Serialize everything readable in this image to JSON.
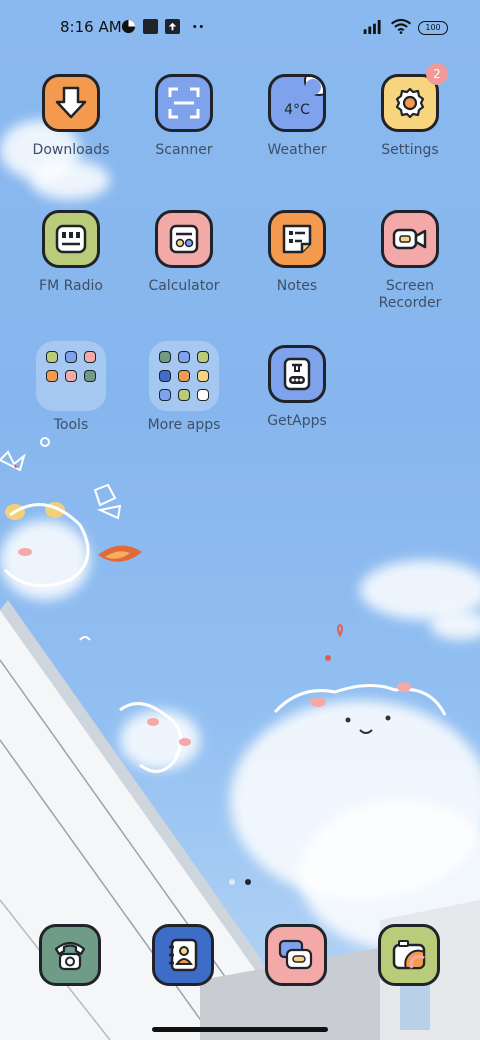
{
  "status_bar": {
    "time": "8:16 AM",
    "battery": "100",
    "left_icons": [
      "data-saver-icon",
      "square-notification-icon",
      "upload-notification-icon",
      "more-dots-icon"
    ],
    "right_icons": [
      "signal-icon",
      "wifi-icon",
      "battery-icon"
    ]
  },
  "apps": {
    "downloads": {
      "label": "Downloads",
      "color": "#f39a4f"
    },
    "scanner": {
      "label": "Scanner",
      "color": "#7ea3ec"
    },
    "weather": {
      "label": "Weather",
      "color": "#7ea3ec",
      "temp": "4°C"
    },
    "settings": {
      "label": "Settings",
      "color": "#f7d57e",
      "badge": "2"
    },
    "fm_radio": {
      "label": "FM Radio",
      "color": "#b8cc7a"
    },
    "calculator": {
      "label": "Calculator",
      "color": "#f4a9a9"
    },
    "notes": {
      "label": "Notes",
      "color": "#f39a4f"
    },
    "screen_recorder": {
      "label": "Screen\nRecorder",
      "color": "#f4a9a9"
    },
    "tools": {
      "label": "Tools"
    },
    "more_apps": {
      "label": "More apps"
    },
    "getapps": {
      "label": "GetApps",
      "color": "#7ea3ec"
    }
  },
  "dock": {
    "phone": {
      "color": "#6e9c86"
    },
    "contacts": {
      "color": "#3e6dc8"
    },
    "messages": {
      "color": "#f4a9a9"
    },
    "camera": {
      "color": "#b8cc7a"
    }
  },
  "page_indicator": {
    "count": 2,
    "active": 2
  }
}
